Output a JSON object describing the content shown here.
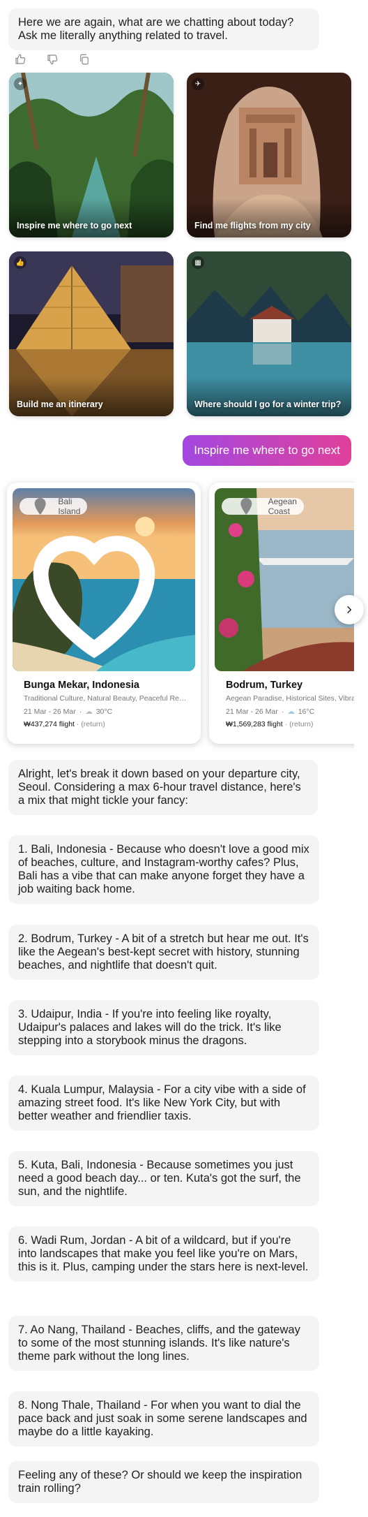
{
  "intro": {
    "text": "Here we are again, what are we chatting about today? Ask me literally anything related to travel."
  },
  "actions": {
    "icons": [
      "thumbs-up-icon",
      "thumbs-down-icon",
      "copy-icon"
    ]
  },
  "tiles": [
    {
      "label": "Inspire me where to go next",
      "icon": "sparkle-icon"
    },
    {
      "label": "Find me flights from my city",
      "icon": "plane-icon"
    },
    {
      "label": "Build me an itinerary",
      "icon": "thumbs-up-icon"
    },
    {
      "label": "Where should I go for a winter trip?",
      "icon": "hotel-icon"
    }
  ],
  "user_message": "Inspire me where to go next",
  "destinations": [
    {
      "location": "Bali Island",
      "title": "Bunga Mekar, Indonesia",
      "tags": "Traditional Culture, Natural Beauty, Peaceful Retr...",
      "dates": "21 Mar - 26 Mar",
      "temp": "30°C",
      "price": "₩437,274 flight",
      "return": "(return)"
    },
    {
      "location": "Aegean Coast",
      "title": "Bodrum, Turkey",
      "tags": "Aegean Paradise, Historical Sites, Vibrant",
      "dates": "21 Mar - 26 Mar",
      "temp": "16°C",
      "price": "₩1,569,283 flight",
      "return": "(return)"
    }
  ],
  "replies": [
    "Alright, let's break it down based on your departure city, Seoul. Considering a max 6-hour travel distance, here's a mix that might tickle your fancy:",
    "1. Bali, Indonesia - Because who doesn't love a good mix of beaches, culture, and Instagram-worthy cafes? Plus, Bali has a vibe that can make anyone forget they have a job waiting back home.",
    "2. Bodrum, Turkey - A bit of a stretch but hear me out. It's like the Aegean's best-kept secret with history, stunning beaches, and nightlife that doesn't quit.",
    "3. Udaipur, India - If you're into feeling like royalty, Udaipur's palaces and lakes will do the trick. It's like stepping into a storybook minus the dragons.",
    "4. Kuala Lumpur, Malaysia - For a city vibe with a side of amazing street food. It's like New York City, but with better weather and friendlier taxis.",
    "5. Kuta, Bali, Indonesia - Because sometimes you just need a good beach day... or ten. Kuta's got the surf, the sun, and the nightlife.",
    "6. Wadi Rum, Jordan - A bit of a wildcard, but if you're into landscapes that make you feel like you're on Mars, this is it. Plus, camping under the stars here is next-level.",
    "7. Ao Nang, Thailand - Beaches, cliffs, and the gateway to some of the most stunning islands. It's like nature's theme park without the long lines.",
    "8. Nong Thale, Thailand - For when you want to dial the pace back and just soak in some serene landscapes and maybe do a little kayaking.",
    "Feeling any of these? Or should we keep the inspiration train rolling?"
  ],
  "colors": {
    "user_gradient_start": "#a347e0",
    "user_gradient_end": "#e0409a",
    "bubble_bg": "#f4f4f4"
  }
}
